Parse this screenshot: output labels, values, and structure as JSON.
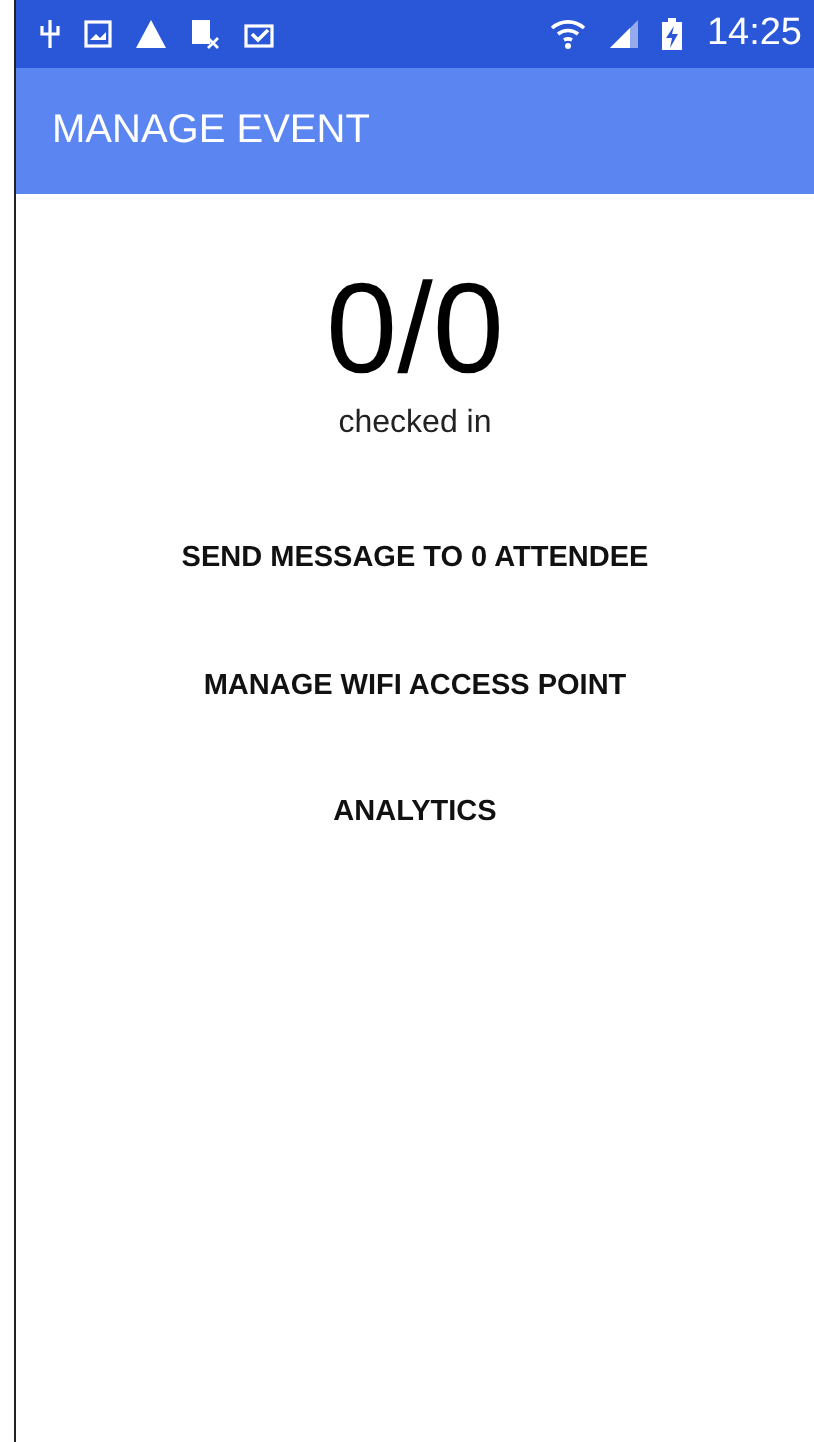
{
  "status_bar": {
    "time": "14:25"
  },
  "app_bar": {
    "title": "MANAGE EVENT"
  },
  "checkin": {
    "count": "0/0",
    "label": "checked in"
  },
  "actions": [
    "SEND MESSAGE TO 0 ATTENDEE",
    "MANAGE WIFI ACCESS POINT",
    "ANALYTICS"
  ]
}
